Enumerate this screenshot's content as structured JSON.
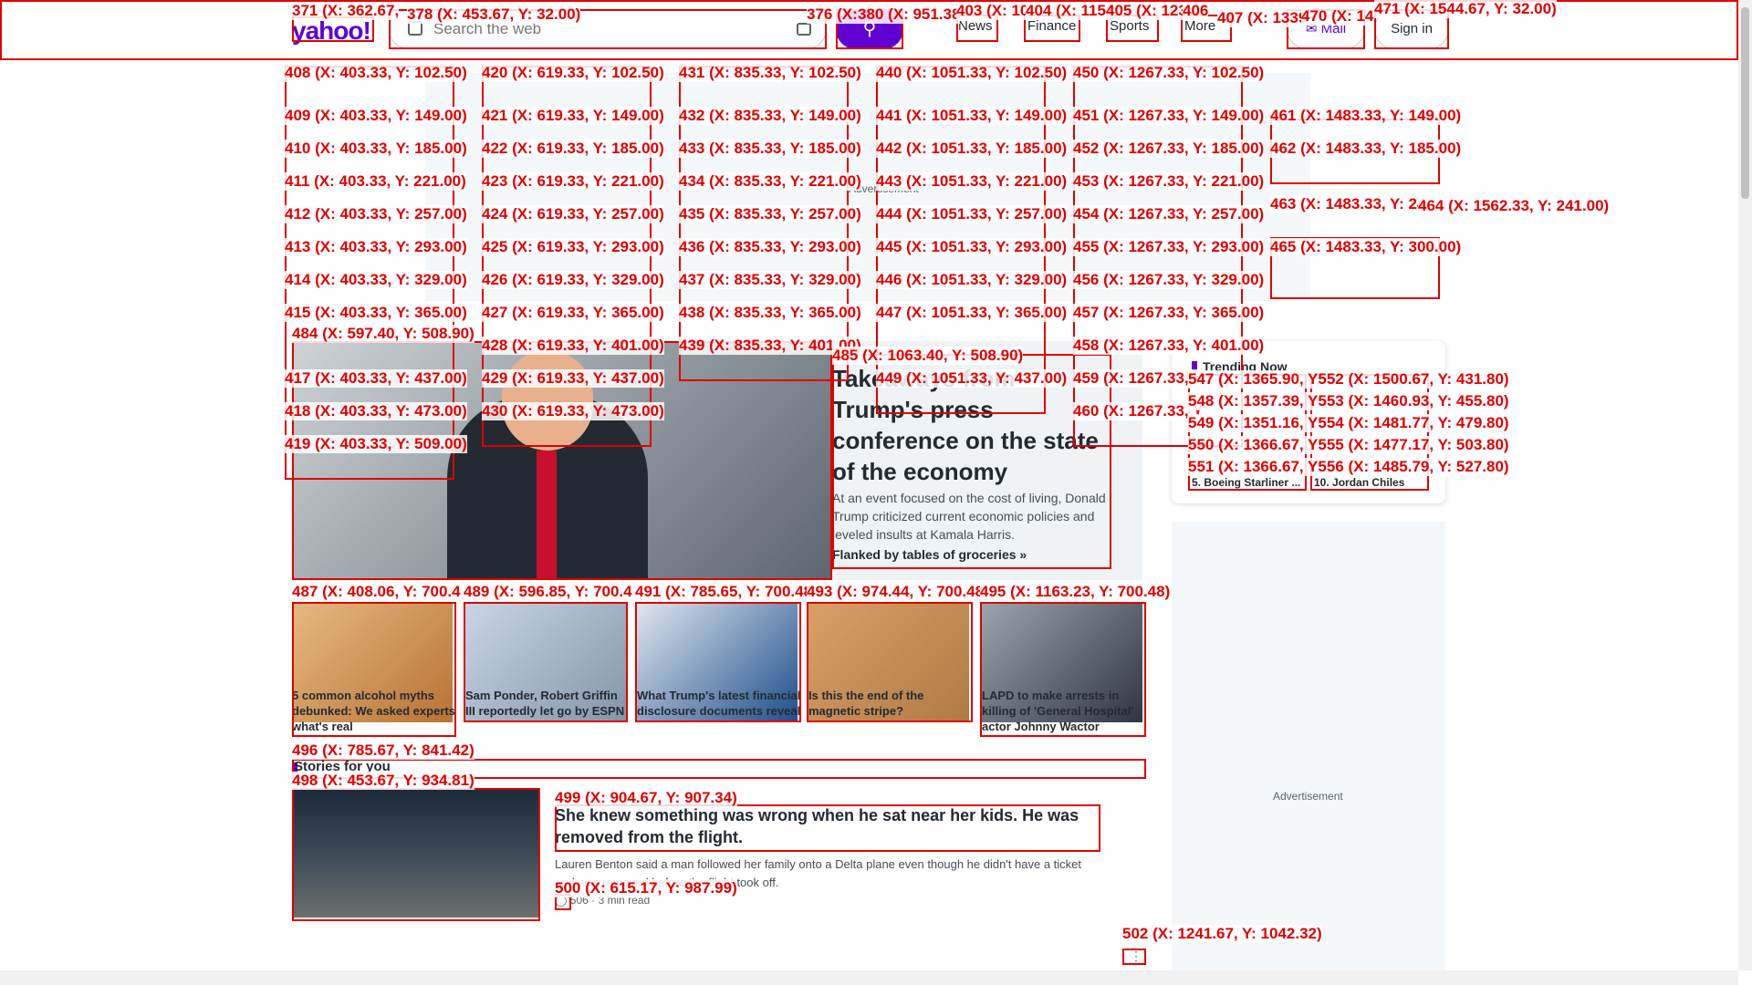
{
  "header": {
    "logo": "yahoo!",
    "search_placeholder": "Search the web",
    "search_icon": "search-icon",
    "nav": [
      "News",
      "Finance",
      "Sports",
      "More"
    ],
    "mail_label": "Mail",
    "signin_label": "Sign in"
  },
  "top_ad": {
    "label": "Advertisement"
  },
  "hero": {
    "title": "Takeaways from Trump's press conference on the state of the economy",
    "summary": "At an event focused on the cost of living, Donald Trump criticized current economic policies and leveled insults at Kamala Harris.",
    "link": "Flanked by tables of groceries »"
  },
  "trending": {
    "title": "Trending Now",
    "items": [
      "5. Boeing Starliner ...",
      "10. Jordan Chiles"
    ]
  },
  "thumbs": [
    {
      "caption": "5 common alcohol myths debunked: We asked experts what's real"
    },
    {
      "caption": "Sam Ponder, Robert Griffin III reportedly let go by ESPN"
    },
    {
      "caption": "What Trump's latest financial disclosure documents reveal"
    },
    {
      "caption": "Is this the end of the magnetic stripe?"
    },
    {
      "caption": "LAPD to make arrests in killing of 'General Hospital' actor Johnny Wactor"
    }
  ],
  "stories": {
    "label": "Stories for you",
    "title": "She knew something was wrong when he sat near her kids. He was removed from the flight.",
    "summary": "Lauren Benton said a man followed her family onto a Delta plane even though he didn't have a ticket and was removed before the flight took off.",
    "comments": "506",
    "read_time": "3 min read"
  },
  "right_ad": {
    "label": "Advertisement"
  },
  "overlay_labels": [
    "371 (X: 362.67,",
    "378 (X: 453.67, Y: 32.00)",
    "376 (X:",
    "380 (X: 951.38",
    "403 (X: 10",
    "404 (X: 1151",
    "405 (X: 123",
    "406",
    "407 (X: 1339",
    "470 (X: 14",
    "471 (X: 1544.67, Y: 32.00)",
    "408 (X: 403.33, Y: 102.50)",
    "420 (X: 619.33, Y: 102.50)",
    "431 (X: 835.33, Y: 102.50)",
    "440 (X: 1051.33, Y: 102.50)",
    "450 (X: 1267.33, Y: 102.50)",
    "409 (X: 403.33, Y: 149.00)",
    "421 (X: 619.33, Y: 149.00)",
    "432 (X: 835.33, Y: 149.00)",
    "441 (X: 1051.33, Y: 149.00)",
    "451 (X: 1267.33, Y: 149.00)",
    "461 (X: 1483.33, Y: 149.00)",
    "410 (X: 403.33, Y: 185.00)",
    "422 (X: 619.33, Y: 185.00)",
    "433 (X: 835.33, Y: 185.00)",
    "442 (X: 1051.33, Y: 185.00)",
    "452 (X: 1267.33, Y: 185.00)",
    "462 (X: 1483.33, Y: 185.00)",
    "411 (X: 403.33, Y: 221.00)",
    "423 (X: 619.33, Y: 221.00)",
    "434 (X: 835.33, Y: 221.00)",
    "443 (X: 1051.33, Y: 221.00)",
    "453 (X: 1267.33, Y: 221.00)",
    "412 (X: 403.33, Y: 257.00)",
    "424 (X: 619.33, Y: 257.00)",
    "435 (X: 835.33, Y: 257.00)",
    "444 (X: 1051.33, Y: 257.00)",
    "454 (X: 1267.33, Y: 257.00)",
    "463 (X: 1483.33, Y: 24",
    "464 (X: 1562.33, Y: 241.00)",
    "413 (X: 403.33, Y: 293.00)",
    "425 (X: 619.33, Y: 293.00)",
    "436 (X: 835.33, Y: 293.00)",
    "445 (X: 1051.33, Y: 293.00)",
    "455 (X: 1267.33, Y: 293.00)",
    "465 (X: 1483.33, Y: 300.00)",
    "414 (X: 403.33, Y: 329.00)",
    "426 (X: 619.33, Y: 329.00)",
    "437 (X: 835.33, Y: 329.00)",
    "446 (X: 1051.33, Y: 329.00)",
    "456 (X: 1267.33, Y: 329.00)",
    "415 (X: 403.33, Y: 365.00)",
    "427 (X: 619.33, Y: 365.00)",
    "438 (X: 835.33, Y: 365.00)",
    "447 (X: 1051.33, Y: 365.00)",
    "457 (X: 1267.33, Y: 365.00)",
    "484 (X: 597.40, Y: 508.90)",
    "428 (X: 619.33, Y: 401.00)",
    "439 (X: 835.33, Y: 401.00)",
    "458 (X: 1267.33, Y: 401.00)",
    "485 (X: 1063.40, Y: 508.90)",
    "417 (X: 403.33, Y: 437.00)",
    "429 (X: 619.33, Y: 437.00)",
    "449 (X: 1051.33, Y: 437.00)",
    "459 (X: 1267.33, Y",
    "418 (X: 403.33, Y: 473.00)",
    "430 (X: 619.33, Y: 473.00)",
    "460 (X: 1267.33, Y",
    "419 (X: 403.33, Y: 509.00)",
    "547 (X: 1365.90, Y552 (X: 1500.67, Y: 431.80)",
    "548 (X: 1357.39, Y553 (X: 1460.93, Y: 455.80)",
    "549 (X: 1351.16, Y554 (X: 1481.77, Y: 479.80)",
    "550 (X: 1366.67, Y555 (X: 1477.17, Y: 503.80)",
    "551 (X: 1366.67, Y556 (X: 1485.79, Y: 527.80)",
    "487 (X: 408.06, Y: 700.4",
    "489 (X: 596.85, Y: 700.4",
    "491 (X: 785.65, Y: 700.48",
    "493 (X: 974.44, Y: 700.48",
    "495 (X: 1163.23, Y: 700.48)",
    "496 (X: 785.67, Y: 841.42)",
    "498 (X: 453.67, Y: 934.81)",
    "499 (X: 904.67, Y: 907.34)",
    "500 (X: 615.17, Y: 987.99)",
    "502 (X: 1241.67, Y: 1042.32)"
  ]
}
